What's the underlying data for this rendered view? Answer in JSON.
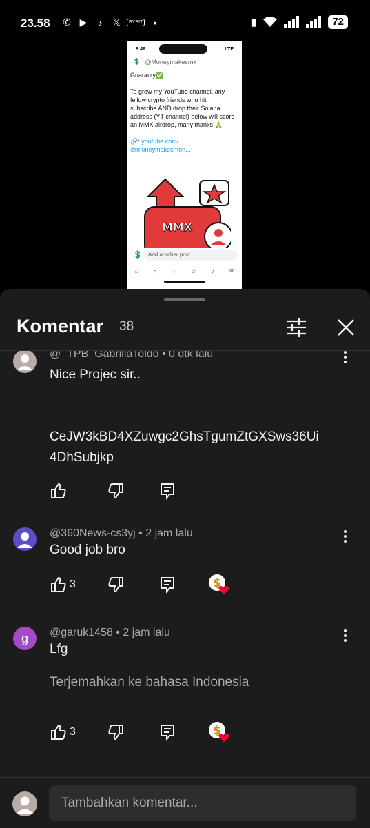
{
  "status_bar": {
    "time": "23.58",
    "apps": [
      "whatsapp-icon",
      "youtube-icon",
      "tiktok-icon",
      "x-icon",
      "bybit-icon"
    ],
    "bybit_label": "BYBIT",
    "battery": "72"
  },
  "video": {
    "time": "8:49",
    "network": "LTE",
    "handle": "@Moneymakesmx",
    "post_lines": [
      "Guaranty✅",
      "",
      "To grow my YouTube channel, any",
      "fellow crypto friends who hit",
      "subscribe AND drop their Solana",
      "address (YT channel) below will score",
      "an MMX airdrop, many thanks 🙏"
    ],
    "link_line1": "youtube.com/",
    "link_line2": "@moneymakesmon...",
    "graphic_text": "MMX",
    "add_post_placeholder": "Add another post"
  },
  "comments_sheet": {
    "title": "Komentar",
    "count": "38",
    "comments": [
      {
        "author": "@_TPB_GabrillaToldo",
        "time": "0 dtk lalu",
        "lines": [
          "Nice Projec sir..",
          "",
          "",
          "CeJW3kBD4XZuwgc2GhsTgumZtGXSws36Ui",
          "4DhSubjkp"
        ],
        "likes": "",
        "avatar_color": "#b9aba7"
      },
      {
        "author": "@360News-cs3yj",
        "time": "2 jam lalu",
        "lines": [
          "Good job bro"
        ],
        "likes": "3",
        "avatar_color": "#5b4fc9"
      },
      {
        "author": "@garuk1458",
        "time": "2 jam lalu",
        "lines": [
          "Lfg"
        ],
        "translate": "Terjemahkan ke bahasa Indonesia",
        "likes": "3",
        "avatar_letter": "g",
        "avatar_color": "#a34bc4"
      }
    ]
  },
  "input": {
    "placeholder": "Tambahkan komentar..."
  },
  "colors": {
    "sheet_bg": "#1c1c1c",
    "heart": "#ff0033",
    "link": "#1d9bf0"
  }
}
